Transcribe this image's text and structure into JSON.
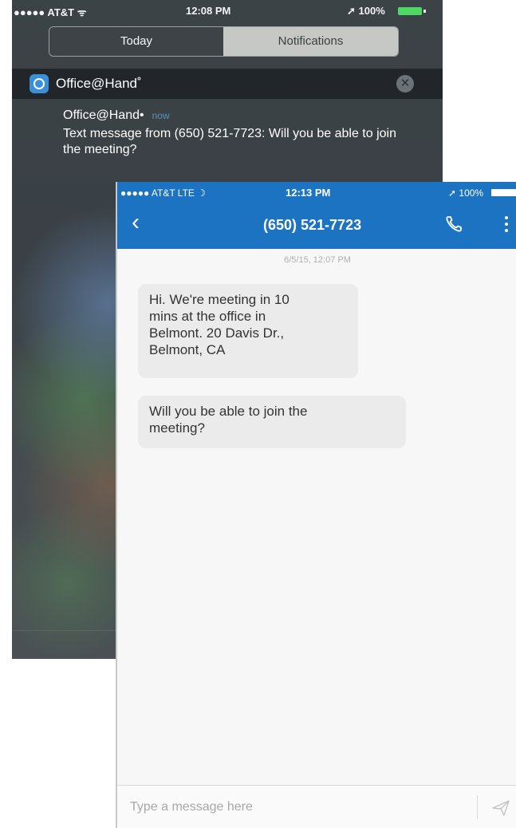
{
  "notification_center": {
    "status_bar": {
      "carrier": "●●●●● AT&T ᯤ",
      "time": "12:08 PM",
      "battery": "➚ 100%"
    },
    "tabs": [
      {
        "label": "Today",
        "selected": false
      },
      {
        "label": "Notifications",
        "selected": true
      }
    ],
    "group": {
      "app_name": "Office@Hand˚",
      "close_glyph": "✕"
    },
    "notification": {
      "sender": "Office@Hand•",
      "time": "now",
      "message": "Text message from (650) 521-7723: Will you be able to join the meeting?"
    }
  },
  "sms_app": {
    "status_bar": {
      "carrier": "●●●●● AT&T  LTE  ☽",
      "time": "12:13 PM",
      "battery": "➚ 100%"
    },
    "nav": {
      "back_glyph": "‹",
      "title": "(650) 521-7723"
    },
    "thread": {
      "date": "6/5/15, 12:07 PM",
      "messages": [
        "Hi. We're meeting in 10\nmins at the office in\nBelmont.  20 Davis Dr.,\nBelmont, CA",
        "Will you be able to join the\nmeeting?"
      ]
    },
    "composer": {
      "placeholder": "Type a message here"
    },
    "colors": {
      "brand_blue": "#1c73c2",
      "bubble_gray": "#ebebeb"
    }
  }
}
